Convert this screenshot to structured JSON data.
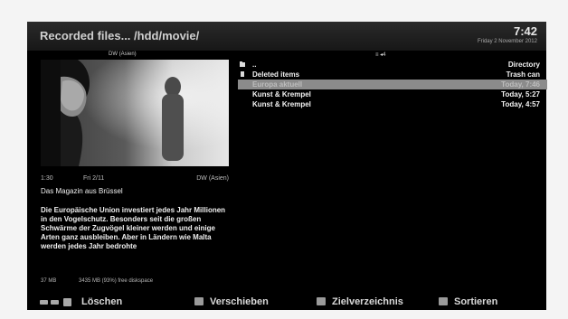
{
  "header": {
    "title": "Recorded files... /hdd/movie/",
    "time": "7:42",
    "date": "Friday 2 November 2012"
  },
  "preview": {
    "channel": "DW (Asien)"
  },
  "info": {
    "time": "1:30",
    "day": "Fri 2/11",
    "channel": "DW (Asien)",
    "title": "Das Magazin aus Brüssel",
    "description": "Die Europäische Union investiert jedes Jahr Millionen in den Vogelschutz. Besonders seit die großen Schwärme der Zugvögel kleiner werden und einige Arten ganz ausbleiben. Aber in Ländern wie Malta werden jedes Jahr bedrohte",
    "disk_size": "37 MB",
    "disk_free": "3435 MB (93%) free diskspace"
  },
  "tuner_indicator": "≡ ◂4",
  "files": [
    {
      "name": "..",
      "info": "Directory",
      "icon": "folder-up-icon",
      "selected": false
    },
    {
      "name": "Deleted items",
      "info": "Trash can",
      "icon": "folder-icon",
      "selected": false
    },
    {
      "name": "Europa aktuell",
      "info": "Today, 7:46",
      "icon": "",
      "selected": true
    },
    {
      "name": "Kunst & Krempel",
      "info": "Today, 5:27",
      "icon": "",
      "selected": false
    },
    {
      "name": "Kunst & Krempel",
      "info": "Today, 4:57",
      "icon": "",
      "selected": false
    }
  ],
  "footer": {
    "red_label": "Löschen",
    "green_label": "Verschieben",
    "yellow_label": "Zielverzeichnis",
    "blue_label": "Sortieren"
  },
  "colors": {
    "red_key": "#9a9a9a",
    "green_key": "#9a9a9a",
    "yellow_key": "#9a9a9a",
    "blue_key": "#9a9a9a",
    "selection": "#8b8b8b"
  }
}
